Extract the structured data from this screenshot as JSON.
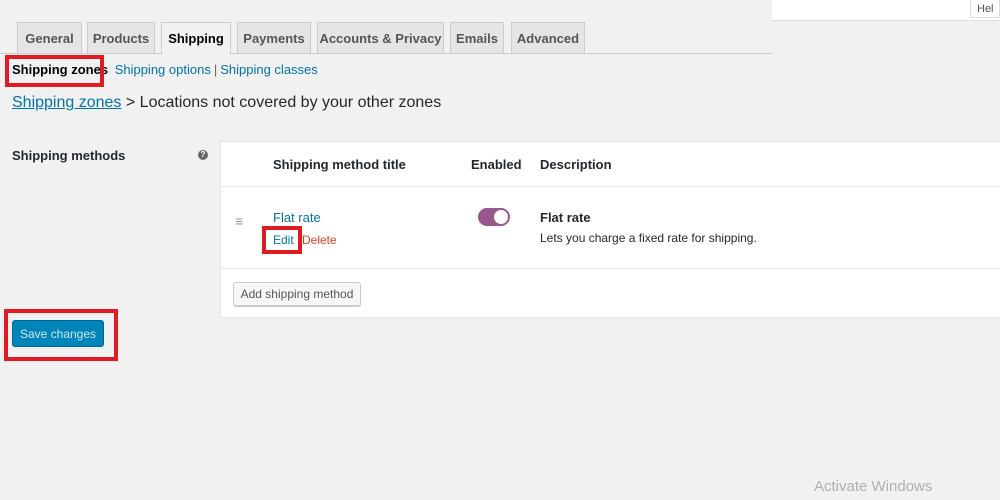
{
  "tabs": [
    {
      "label": "General"
    },
    {
      "label": "Products"
    },
    {
      "label": "Shipping"
    },
    {
      "label": "Payments"
    },
    {
      "label": "Accounts & Privacy"
    },
    {
      "label": "Emails"
    },
    {
      "label": "Advanced"
    }
  ],
  "help_button": "Hel",
  "subnav": {
    "zones": "Shipping zones",
    "options": "Shipping options",
    "classes": "Shipping classes",
    "separator": "|"
  },
  "breadcrumb": {
    "link": "Shipping zones",
    "separator": ">",
    "current": "Locations not covered by your other zones"
  },
  "shipping_methods": {
    "label": "Shipping methods",
    "help_icon": "?",
    "columns": {
      "title": "Shipping method title",
      "enabled": "Enabled",
      "description": "Description"
    },
    "rows": [
      {
        "title": "Flat rate",
        "edit": "Edit",
        "delete": "Delete",
        "enabled": true,
        "description_title": "Flat rate",
        "description": "Lets you charge a fixed rate for shipping."
      }
    ],
    "add_button": "Add shipping method"
  },
  "save_button": "Save changes",
  "watermark": "Activate Windows",
  "colors": {
    "accent": "#0073aa",
    "toggle_on": "#96588a",
    "delete": "#e2401c",
    "primary_button": "#0085ba",
    "highlight": "#e01b24"
  },
  "icons": {
    "drag_handle": "≡"
  }
}
